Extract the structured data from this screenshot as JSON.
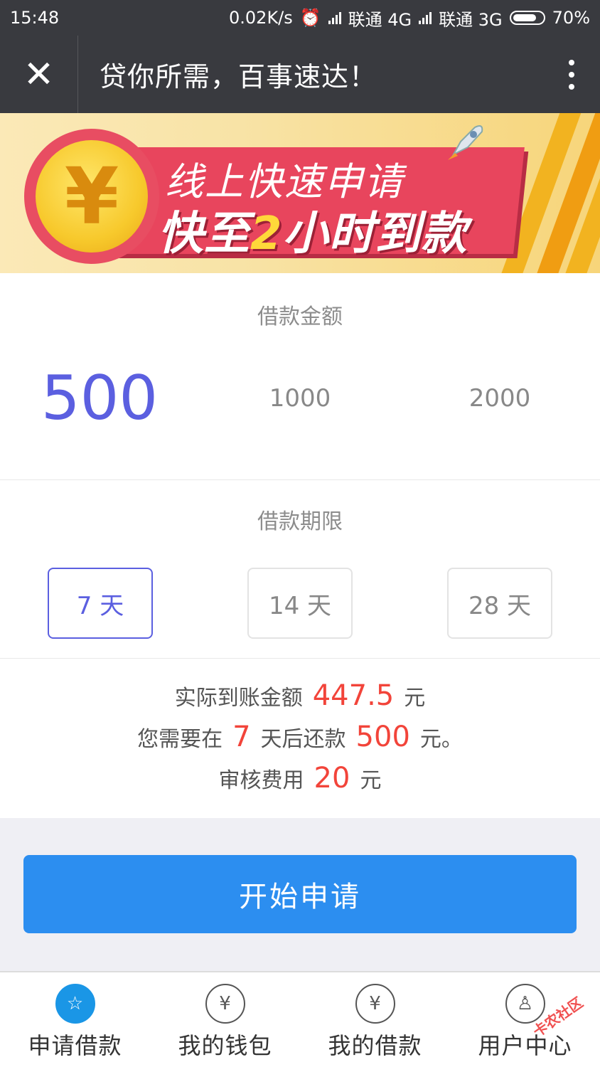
{
  "status_bar": {
    "time": "15:48",
    "speed": "0.02K/s",
    "carrier1": "联通 4G",
    "carrier2": "联通 3G",
    "battery": "70%"
  },
  "header": {
    "title": "贷你所需，百事速达！",
    "close_icon": "✕"
  },
  "banner": {
    "coin_symbol": "¥",
    "line1": "线上快速申请",
    "line2_prefix": "快至",
    "line2_highlight": "2",
    "line2_suffix": "小时到款"
  },
  "loan_amount": {
    "label": "借款金额",
    "options": [
      "500",
      "1000",
      "2000"
    ],
    "selected": "500"
  },
  "loan_term": {
    "label": "借款期限",
    "options": [
      "7 天",
      "14 天",
      "28 天"
    ],
    "selected": "7 天"
  },
  "summary": {
    "line1_prefix": "实际到账金额",
    "line1_value": "447.5",
    "line1_suffix": "元",
    "line2_prefix": "您需要在",
    "line2_days": "7",
    "line2_mid": "天后还款",
    "line2_value": "500",
    "line2_suffix": "元。",
    "line3_prefix": "审核费用",
    "line3_value": "20",
    "line3_suffix": "元"
  },
  "apply_button": "开始申请",
  "tabs": [
    {
      "label": "申请借款",
      "icon": "star-icon",
      "glyph": "☆"
    },
    {
      "label": "我的钱包",
      "icon": "money-bag-icon",
      "glyph": "¥"
    },
    {
      "label": "我的借款",
      "icon": "yen-coin-icon",
      "glyph": "¥"
    },
    {
      "label": "用户中心",
      "icon": "user-icon",
      "glyph": "♙"
    }
  ],
  "watermark": "卡农社区",
  "colors": {
    "accent": "#5b5fe0",
    "button": "#2c8ef0",
    "highlight": "#f2443a",
    "bar": "#393a3f"
  }
}
